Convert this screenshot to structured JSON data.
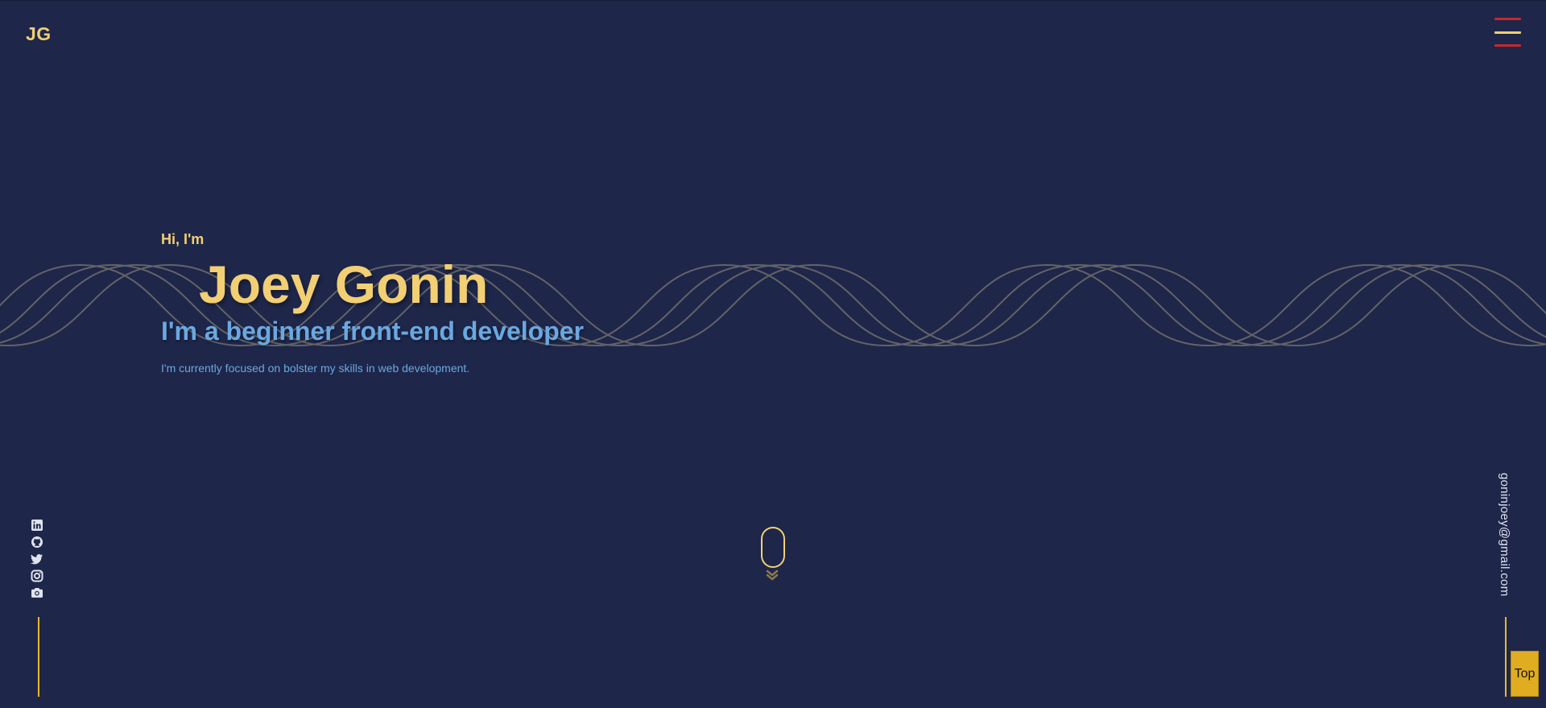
{
  "header": {
    "logo": "JG",
    "menu_icon": "hamburger-menu-icon"
  },
  "hero": {
    "greeting": "Hi, I'm",
    "name": "Joey Gonin",
    "role": "I'm a beginner front-end developer",
    "tagline": "I'm currently focused on bolster my skills in web development."
  },
  "socials": [
    {
      "icon": "linkedin-icon"
    },
    {
      "icon": "github-icon"
    },
    {
      "icon": "twitter-icon"
    },
    {
      "icon": "instagram-icon"
    },
    {
      "icon": "camera-icon"
    }
  ],
  "contact": {
    "email": "goninjoey@gmail.com"
  },
  "scroll_indicator": {
    "icon": "mouse-scroll-icon"
  },
  "top_button": {
    "label": "Top"
  },
  "colors": {
    "background": "#1e264a",
    "accent_yellow": "#f2cf73",
    "accent_blue": "#6aa8e0",
    "menu_red": "#c8282b",
    "button_gold": "#e0ad21",
    "wave_gray": "#6b6a6a"
  }
}
